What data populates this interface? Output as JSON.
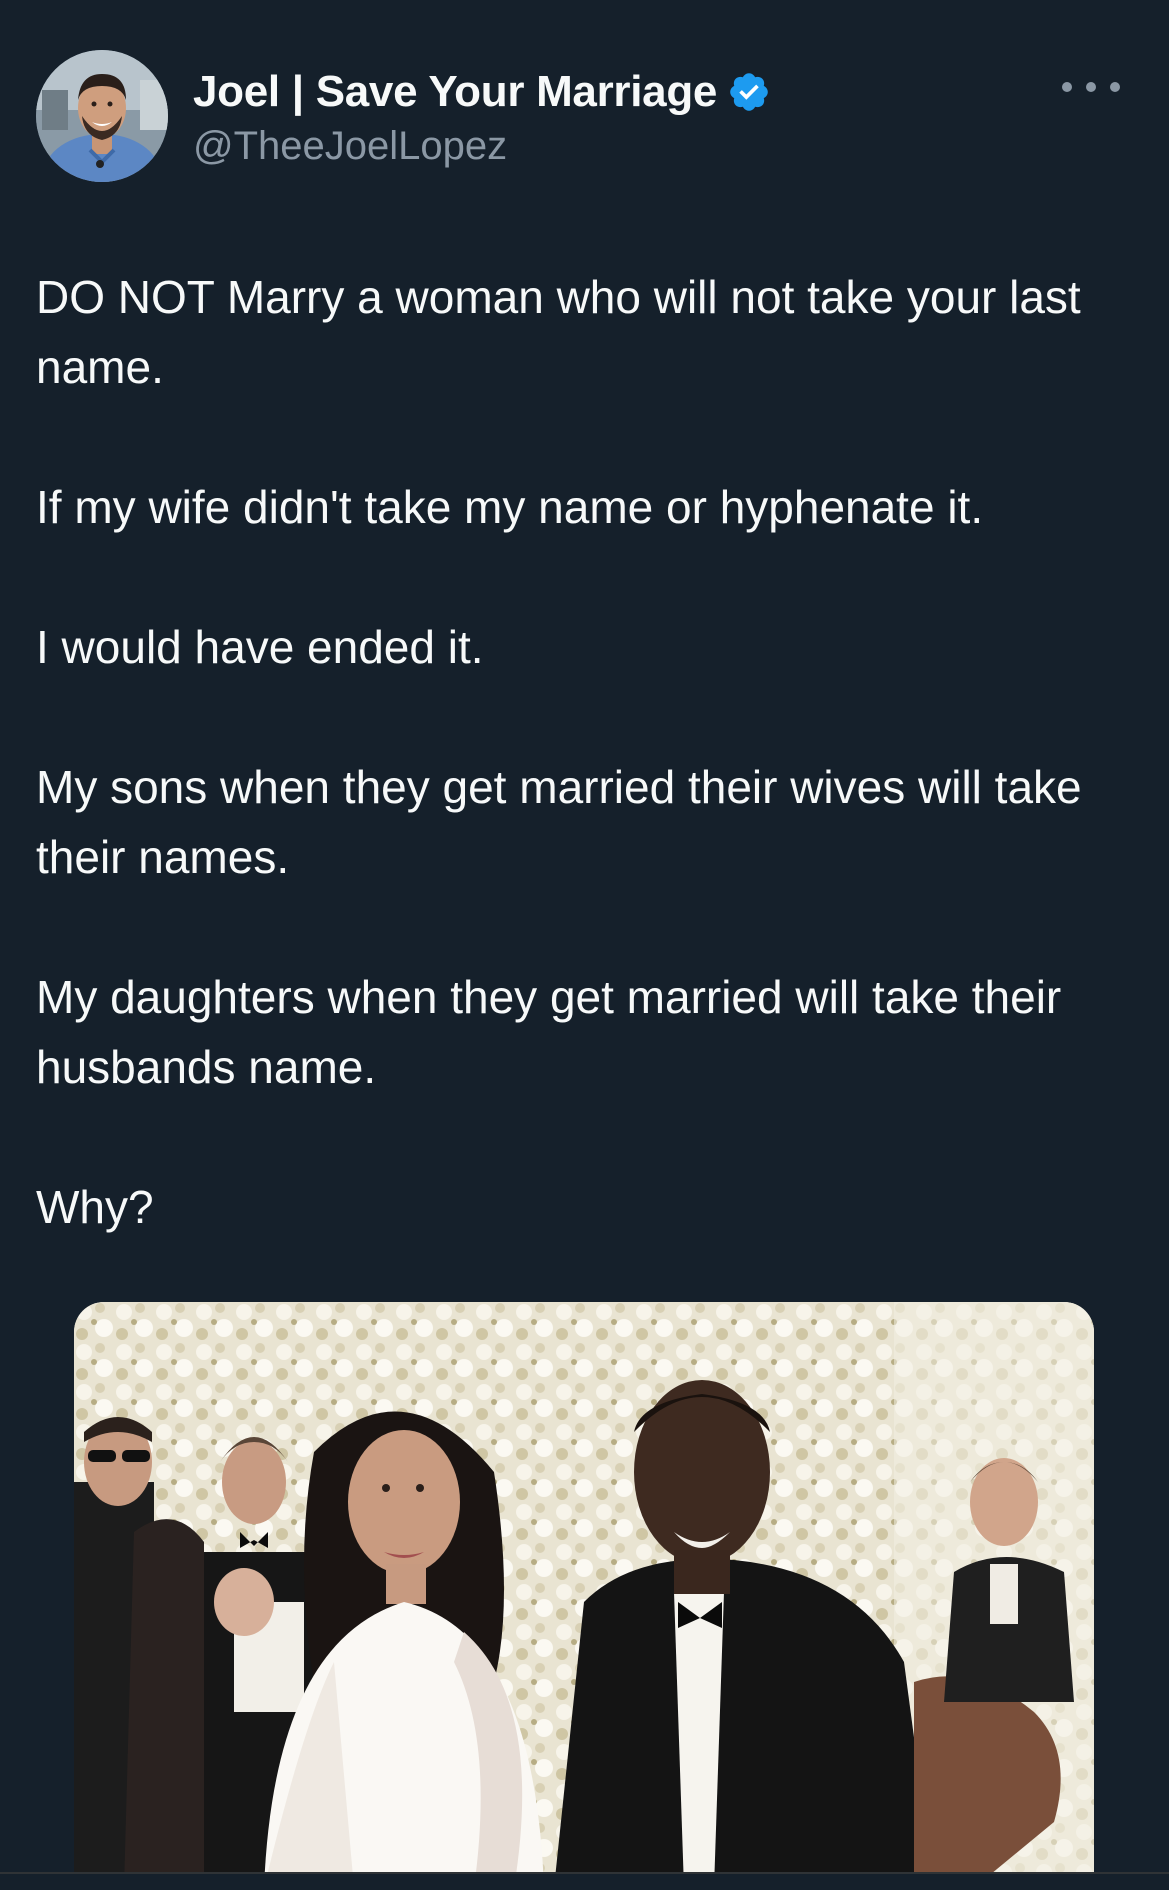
{
  "tweet": {
    "author": {
      "display_name": "Joel | Save Your Marriage",
      "handle": "@TheeJoelLopez",
      "verified": true,
      "verified_icon": "verified-badge-icon",
      "avatar_icon": "avatar"
    },
    "more_icon": "more-options-icon",
    "paragraphs": [
      "DO NOT Marry a woman who will not take your last name.",
      "If my wife didn't take my name or hyphenate it.",
      "I would have ended it.",
      "My sons when they get married their wives will take their names.",
      "My daughters when they get married will take their husbands name.",
      "Why?"
    ],
    "media": {
      "type": "photo"
    }
  },
  "colors": {
    "background": "#15202b",
    "text_primary": "#f7f9f9",
    "text_secondary": "#8b98a5",
    "verified_blue": "#1d9bf0"
  }
}
